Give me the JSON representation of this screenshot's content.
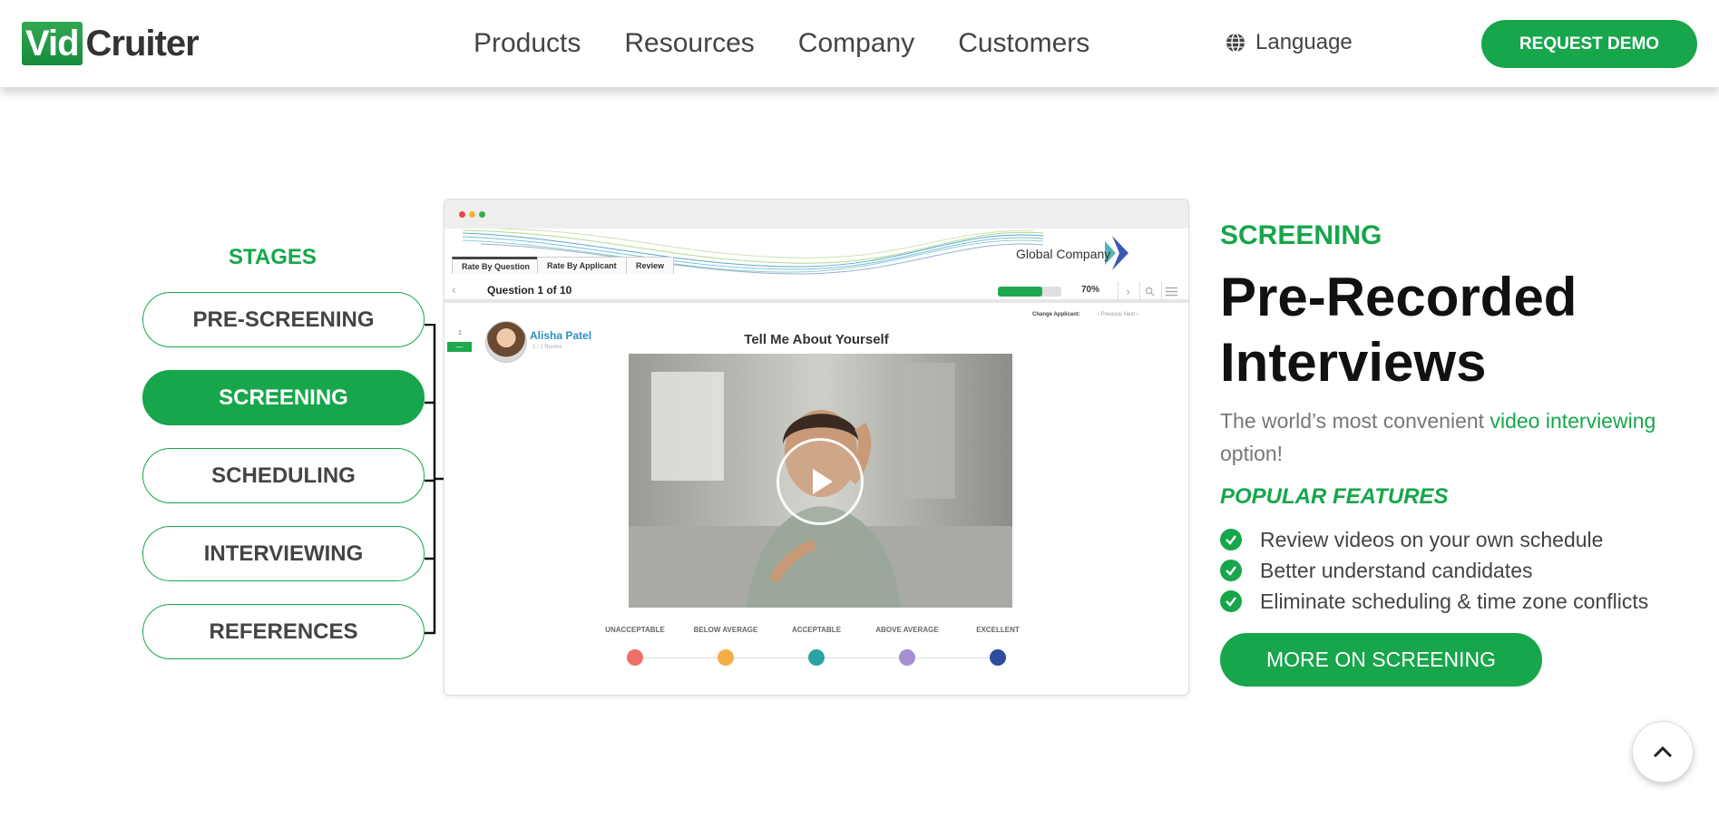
{
  "header": {
    "logo_vid": "Vid",
    "logo_cruiter": "Cruiter",
    "nav": [
      "Products",
      "Resources",
      "Company",
      "Customers"
    ],
    "language": "Language",
    "demo_button": "REQUEST DEMO"
  },
  "stages": {
    "title": "STAGES",
    "items": [
      "PRE-SCREENING",
      "SCREENING",
      "SCHEDULING",
      "INTERVIEWING",
      "REFERENCES"
    ],
    "active": "SCREENING"
  },
  "preview": {
    "company": "Global Company",
    "tabs": [
      "Rate By Question",
      "Rate By Applicant",
      "Review"
    ],
    "question": "Question 1 of 10",
    "progress_percent": 70,
    "progress_label": "70%",
    "change_applicant": "Change Applicant:",
    "change_nav": "‹ Previous   Next ›",
    "candidate_name": "Alisha Patel",
    "candidate_sub": "1 / 1 Rooms",
    "side_number": "1",
    "video_title": "Tell Me About Yourself",
    "ratings": [
      {
        "label": "UNACCEPTABLE",
        "color": "#ef6f6c"
      },
      {
        "label": "BELOW AVERAGE",
        "color": "#f4ae44"
      },
      {
        "label": "ACCEPTABLE",
        "color": "#2aa3a3"
      },
      {
        "label": "ABOVE AVERAGE",
        "color": "#a48fcf"
      },
      {
        "label": "EXCELLENT",
        "color": "#2f4c9e"
      }
    ]
  },
  "content": {
    "section_label": "SCREENING",
    "headline": "Pre-Recorded Interviews",
    "sub_before": "The world’s most convenient ",
    "sub_link": "video interviewing",
    "sub_after": " option!",
    "popular_title": "POPULAR FEATURES",
    "features": [
      "Review videos on your own schedule",
      "Better understand candidates",
      "Eliminate scheduling & time zone conflicts"
    ],
    "more_button": "MORE ON SCREENING"
  },
  "colors": {
    "brand_green": "#17a64b"
  }
}
